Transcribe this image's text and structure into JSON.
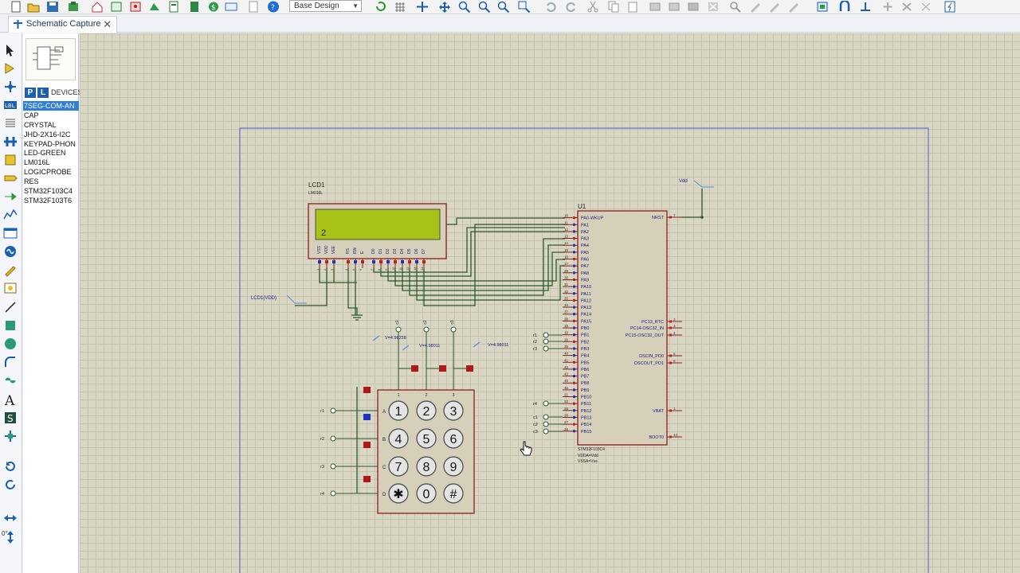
{
  "toolbar": {
    "variant_value": "Base Design"
  },
  "tabs": [
    {
      "label": "Schematic Capture"
    }
  ],
  "tool_panel": {
    "angle_label": "0°"
  },
  "device_panel": {
    "pick_label": "P",
    "library_label": "L",
    "header": "DEVICES",
    "devices": [
      "7SEG-COM-AN",
      "CAP",
      "CRYSTAL",
      "JHD-2X16-I2C",
      "KEYPAD-PHON",
      "LED-GREEN",
      "LM016L",
      "LOGICPROBE",
      "RES",
      "STM32F103C4",
      "STM32F103T6"
    ],
    "selected_index": 0
  },
  "schematic": {
    "lcd": {
      "ref": "LCD1",
      "part": "LM016L",
      "display_text": "2",
      "pins": [
        "VSS",
        "VDD",
        "VEE",
        "RS",
        "RW",
        "E",
        "D0",
        "D1",
        "D2",
        "D3",
        "D4",
        "D5",
        "D6",
        "D7"
      ],
      "pin_nums": [
        "1",
        "2",
        "3",
        "4",
        "5",
        "6",
        "7",
        "8",
        "9",
        "10",
        "11",
        "12",
        "13",
        "14"
      ]
    },
    "mcu": {
      "ref": "U1",
      "part": "STM32F103C4",
      "notes": [
        "VDDA=Vdd",
        "VSSA=Vss"
      ],
      "left_pins": [
        {
          "num": "10",
          "name": "PA0-WKUP"
        },
        {
          "num": "11",
          "name": "PA1"
        },
        {
          "num": "12",
          "name": "PA2"
        },
        {
          "num": "13",
          "name": "PA3"
        },
        {
          "num": "14",
          "name": "PA4"
        },
        {
          "num": "15",
          "name": "PA5"
        },
        {
          "num": "16",
          "name": "PA6"
        },
        {
          "num": "17",
          "name": "PA7"
        },
        {
          "num": "29",
          "name": "PA8"
        },
        {
          "num": "30",
          "name": "PA9"
        },
        {
          "num": "31",
          "name": "PA10"
        },
        {
          "num": "32",
          "name": "PA11"
        },
        {
          "num": "33",
          "name": "PA12"
        },
        {
          "num": "34",
          "name": "PA13"
        },
        {
          "num": "37",
          "name": "PA14"
        },
        {
          "num": "38",
          "name": "PA15"
        },
        {
          "num": "18",
          "name": "PB0"
        },
        {
          "num": "19",
          "name": "PB1"
        },
        {
          "num": "20",
          "name": "PB2"
        },
        {
          "num": "39",
          "name": "PB3"
        },
        {
          "num": "40",
          "name": "PB4"
        },
        {
          "num": "41",
          "name": "PB5"
        },
        {
          "num": "42",
          "name": "PB6"
        },
        {
          "num": "43",
          "name": "PB7"
        },
        {
          "num": "45",
          "name": "PB8"
        },
        {
          "num": "46",
          "name": "PB9"
        },
        {
          "num": "21",
          "name": "PB10"
        },
        {
          "num": "22",
          "name": "PB11"
        },
        {
          "num": "25",
          "name": "PB12"
        },
        {
          "num": "26",
          "name": "PB13"
        },
        {
          "num": "27",
          "name": "PB14"
        },
        {
          "num": "28",
          "name": "PB15"
        }
      ],
      "right_pins": [
        {
          "num": "7",
          "name": "NRST"
        },
        {
          "num": "2",
          "name": "PC13_RTC"
        },
        {
          "num": "3",
          "name": "PC14-OSC32_IN"
        },
        {
          "num": "4",
          "name": "PC15-OSC32_OUT"
        },
        {
          "num": "5",
          "name": "OSCIN_PD0"
        },
        {
          "num": "6",
          "name": "OSCOUT_PD1"
        },
        {
          "num": "1",
          "name": "VBAT"
        },
        {
          "num": "44",
          "name": "BOOT0"
        }
      ]
    },
    "power_labels": {
      "vdd": "Vdd",
      "lcd_vdd": "LCD1(VDD)"
    },
    "mcu_net_labels": {
      "rows": [
        "r1",
        "r2",
        "r3",
        "r4"
      ],
      "cols": [
        "c1",
        "c2",
        "c3"
      ]
    },
    "keypad": {
      "keys": [
        "1",
        "2",
        "3",
        "4",
        "5",
        "6",
        "7",
        "8",
        "9",
        "✱",
        "0",
        "#"
      ],
      "row_letters": [
        "A",
        "B",
        "C",
        "D"
      ],
      "col_numbers": [
        "1",
        "2",
        "3"
      ],
      "row_nets": [
        "r1",
        "r2",
        "r3",
        "r4"
      ],
      "col_nets": [
        "c1",
        "c2",
        "c3"
      ]
    },
    "probes": [
      {
        "net": "c1",
        "voltage": "V=4.98258"
      },
      {
        "net": "c2",
        "voltage": "V=4.98011"
      },
      {
        "net": "c3",
        "voltage": "V=4.98011"
      }
    ],
    "logic_states": [
      "1",
      "1",
      "1",
      "?",
      "0",
      "1",
      "1"
    ]
  }
}
